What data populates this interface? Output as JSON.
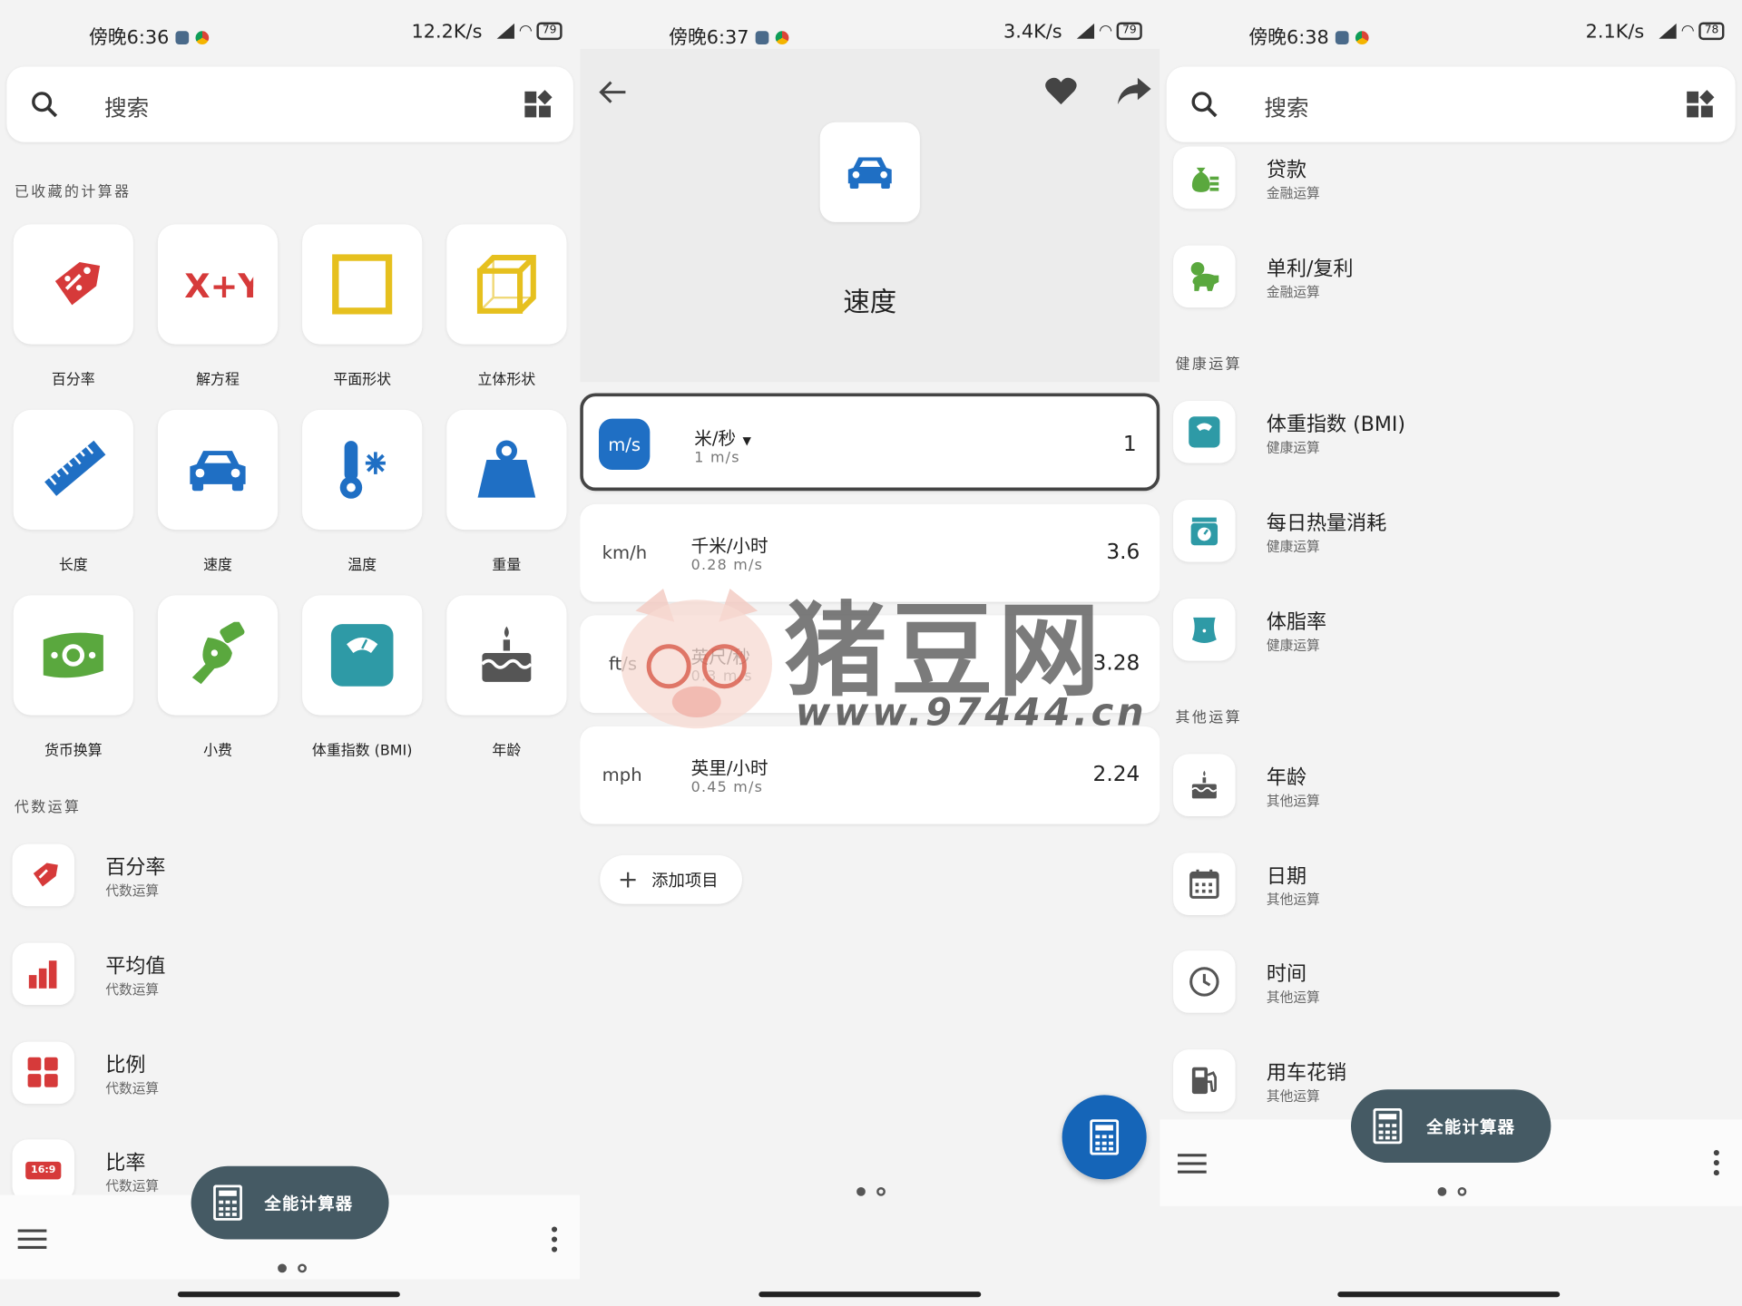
{
  "panels": [
    {
      "status": {
        "time": "傍晚6:36",
        "speed": "12.2K/s",
        "battery": "79"
      },
      "search": {
        "placeholder": "搜索"
      },
      "favorites": {
        "heading": "已收藏的计算器",
        "tiles": [
          {
            "label": "百分率",
            "icon": "percent-tag-icon",
            "color": "#d63a3a"
          },
          {
            "label": "解方程",
            "icon": "equation-icon",
            "color": "#d63a3a"
          },
          {
            "label": "平面形状",
            "icon": "square-shape-icon",
            "color": "#e6c01e"
          },
          {
            "label": "立体形状",
            "icon": "cube-shape-icon",
            "color": "#e6c01e"
          },
          {
            "label": "长度",
            "icon": "ruler-icon",
            "color": "#1f6fc4"
          },
          {
            "label": "速度",
            "icon": "car-icon",
            "color": "#1f6fc4"
          },
          {
            "label": "温度",
            "icon": "thermometer-icon",
            "color": "#1f6fc4"
          },
          {
            "label": "重量",
            "icon": "weight-icon",
            "color": "#1f6fc4"
          },
          {
            "label": "货币换算",
            "icon": "money-icon",
            "color": "#5aa83e"
          },
          {
            "label": "小费",
            "icon": "tip-hand-icon",
            "color": "#5aa83e"
          },
          {
            "label": "体重指数 (BMI)",
            "icon": "scale-icon",
            "color": "#2e9aa6"
          },
          {
            "label": "年龄",
            "icon": "cake-icon",
            "color": "#555555"
          }
        ]
      },
      "algebra": {
        "heading": "代数运算",
        "items": [
          {
            "title": "百分率",
            "sub": "代数运算",
            "icon": "percent-tag-icon"
          },
          {
            "title": "平均值",
            "sub": "代数运算",
            "icon": "bar-chart-icon"
          },
          {
            "title": "比例",
            "sub": "代数运算",
            "icon": "grid-icon"
          },
          {
            "title": "比率",
            "sub": "代数运算",
            "icon": "ratio-icon",
            "badge": "16:9"
          }
        ]
      },
      "fab": {
        "label": "全能计算器"
      }
    },
    {
      "status": {
        "time": "傍晚6:37",
        "speed": "3.4K/s",
        "battery": "79"
      },
      "title": "速度",
      "rows": [
        {
          "code": "m/s",
          "name": "米/秒",
          "rate": "1 m/s",
          "value": "1"
        },
        {
          "code": "km/h",
          "name": "千米/小时",
          "rate": "0.28 m/s",
          "value": "3.6"
        },
        {
          "code": "ft/s",
          "name": "英尺/秒",
          "rate": "0.3 m/s",
          "value": "3.28"
        },
        {
          "code": "mph",
          "name": "英里/小时",
          "rate": "0.45 m/s",
          "value": "2.24"
        }
      ],
      "add_label": "添加项目"
    },
    {
      "status": {
        "time": "傍晚6:38",
        "speed": "2.1K/s",
        "battery": "78"
      },
      "search": {
        "placeholder": "搜索"
      },
      "finance": [
        {
          "title": "贷款",
          "sub": "金融运算",
          "icon": "money-bag-icon"
        },
        {
          "title": "单利/复利",
          "sub": "金融运算",
          "icon": "piggy-bank-icon"
        }
      ],
      "health_heading": "健康运算",
      "health": [
        {
          "title": "体重指数 (BMI)",
          "sub": "健康运算",
          "icon": "scale-icon"
        },
        {
          "title": "每日热量消耗",
          "sub": "健康运算",
          "icon": "kitchen-scale-icon"
        },
        {
          "title": "体脂率",
          "sub": "健康运算",
          "icon": "body-icon"
        }
      ],
      "other_heading": "其他运算",
      "other": [
        {
          "title": "年龄",
          "sub": "其他运算",
          "icon": "cake-icon"
        },
        {
          "title": "日期",
          "sub": "其他运算",
          "icon": "calendar-icon"
        },
        {
          "title": "时间",
          "sub": "其他运算",
          "icon": "clock-icon"
        },
        {
          "title": "用车花销",
          "sub": "其他运算",
          "icon": "fuel-icon"
        }
      ],
      "fab": {
        "label": "全能计算器"
      }
    }
  ],
  "watermark": {
    "brand": "猪豆网",
    "url": "www.97444.cn"
  }
}
